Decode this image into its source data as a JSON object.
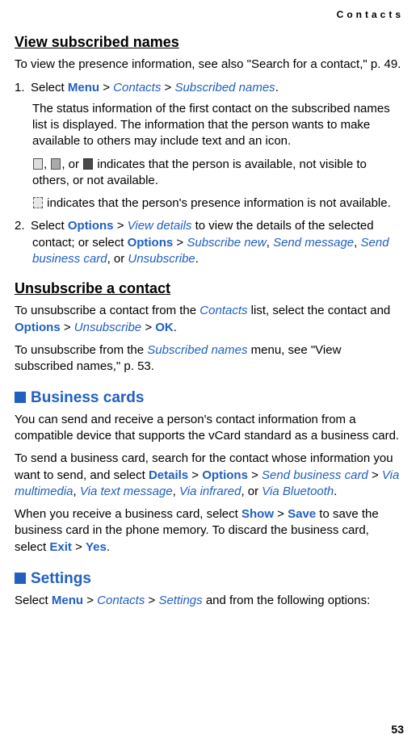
{
  "header": {
    "label": "Contacts",
    "pageNumber": "53"
  },
  "s1": {
    "title": "View subscribed names",
    "intro_a": "To view the presence information, see also \"Search for a contact,\" p. 49.",
    "step1_num": "1.",
    "step1_a": "Select ",
    "step1_menu": "Menu",
    "step1_gt1": " > ",
    "step1_contacts": "Contacts",
    "step1_gt2": " > ",
    "step1_sub": "Subscribed names",
    "step1_dot": ".",
    "step1_p1": "The status information of the first contact on the subscribed names list is displayed. The information that the person wants to make available to others may include text and an icon.",
    "step1_p2_mid": ", or ",
    "step1_p2_b": " indicates that the person is available, not visible to others, or not available.",
    "step1_p3": " indicates that the person's presence information is not available.",
    "step2_num": "2.",
    "step2_a": "Select ",
    "step2_options": "Options",
    "step2_gt1": " > ",
    "step2_view": "View details",
    "step2_b": " to view the details of the selected contact; or select ",
    "step2_options2": "Options",
    "step2_gt2": " > ",
    "step2_subnew": "Subscribe new",
    "step2_c1": ", ",
    "step2_sendmsg": "Send message",
    "step2_c2": ", ",
    "step2_sendbc": "Send business card",
    "step2_c3": ", or ",
    "step2_unsub": "Unsubscribe",
    "step2_dot": "."
  },
  "s2": {
    "title": "Unsubscribe a contact",
    "p1_a": "To unsubscribe a contact from the ",
    "p1_contacts": "Contacts",
    "p1_b": " list, select the contact and ",
    "p1_options": "Options",
    "p1_gt1": " > ",
    "p1_unsub": "Unsubscribe",
    "p1_gt2": " > ",
    "p1_ok": "OK",
    "p1_dot": ".",
    "p2_a": "To unsubscribe from the ",
    "p2_sub": "Subscribed names",
    "p2_b": " menu, see \"View subscribed names,\" p. 53."
  },
  "s3": {
    "title": "Business cards",
    "p1": "You can send and receive a person's contact information from a compatible device that supports the vCard standard as a business card.",
    "p2_a": "To send a business card, search for the contact whose information you want to send, and select ",
    "p2_details": "Details",
    "p2_gt1": " > ",
    "p2_options": "Options",
    "p2_gt2": " > ",
    "p2_sendbc": "Send business card",
    "p2_gt3": " > ",
    "p2_mm": "Via multimedia",
    "p2_c1": ", ",
    "p2_text": "Via text message",
    "p2_c2": ", ",
    "p2_ir": "Via infrared",
    "p2_c3": ", or ",
    "p2_bt": "Via Bluetooth",
    "p2_dot": ".",
    "p3_a": "When you receive a business card, select ",
    "p3_show": "Show",
    "p3_gt1": " > ",
    "p3_save": "Save",
    "p3_b": " to save the business card in the phone memory. To discard the business card, select ",
    "p3_exit": "Exit",
    "p3_gt2": " > ",
    "p3_yes": "Yes",
    "p3_dot": "."
  },
  "s4": {
    "title": "Settings",
    "p1_a": "Select ",
    "p1_menu": "Menu",
    "p1_gt1": " > ",
    "p1_contacts": "Contacts",
    "p1_gt2": " > ",
    "p1_settings": "Settings",
    "p1_b": " and from the following options:"
  }
}
